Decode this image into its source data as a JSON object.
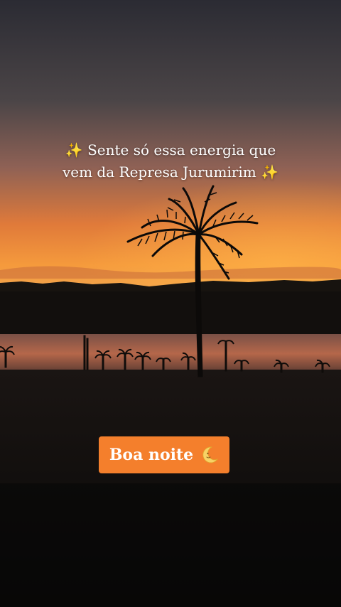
{
  "caption": {
    "line1": "✨ Sente só essa energia que",
    "line2": "vem da Represa Jurumirim ✨"
  },
  "badge": {
    "label": "Boa noite",
    "icon": "crescent-moon-face-icon",
    "background": "#f47f2c"
  },
  "scene": {
    "icons": [
      "palm-tree",
      "lake",
      "sunset-sky"
    ],
    "colors": {
      "sky_top": "#2f2f38",
      "sky_mid": "#7a5b59",
      "horizon": "#f39a3a",
      "ground": "#0d0b0a"
    }
  }
}
